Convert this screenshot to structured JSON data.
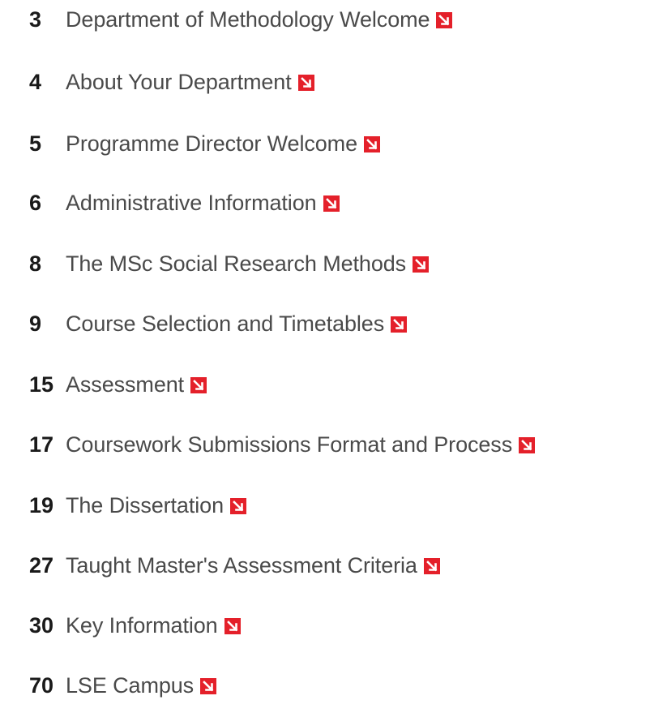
{
  "toc": {
    "entries": [
      {
        "page": "3",
        "title": "Department of Methodology Welcome",
        "icon": "arrow-down-right-icon"
      },
      {
        "page": "4",
        "title": "About Your Department",
        "icon": "arrow-down-right-icon"
      },
      {
        "page": "5",
        "title": "Programme Director Welcome",
        "icon": "arrow-down-right-icon"
      },
      {
        "page": "6",
        "title": "Administrative Information",
        "icon": "arrow-down-right-icon"
      },
      {
        "page": "8",
        "title": "The MSc Social Research Methods",
        "icon": "arrow-down-right-icon"
      },
      {
        "page": "9",
        "title": "Course Selection and Timetables",
        "icon": "arrow-down-right-icon"
      },
      {
        "page": "15",
        "title": "Assessment",
        "icon": "arrow-down-right-icon"
      },
      {
        "page": "17",
        "title": "Coursework Submissions Format and Process",
        "icon": "arrow-down-right-icon"
      },
      {
        "page": "19",
        "title": "The Dissertation",
        "icon": "arrow-down-right-icon"
      },
      {
        "page": "27",
        "title": "Taught Master's Assessment Criteria",
        "icon": "arrow-down-right-icon"
      },
      {
        "page": "30",
        "title": "Key Information",
        "icon": "arrow-down-right-icon"
      },
      {
        "page": "70",
        "title": "LSE Campus",
        "icon": "arrow-down-right-icon"
      }
    ]
  },
  "colors": {
    "page_number": "#1a1a1a",
    "title_text": "#4a4a4a",
    "arrow_background": "#e4202a",
    "arrow_glyph": "#ffffff"
  }
}
